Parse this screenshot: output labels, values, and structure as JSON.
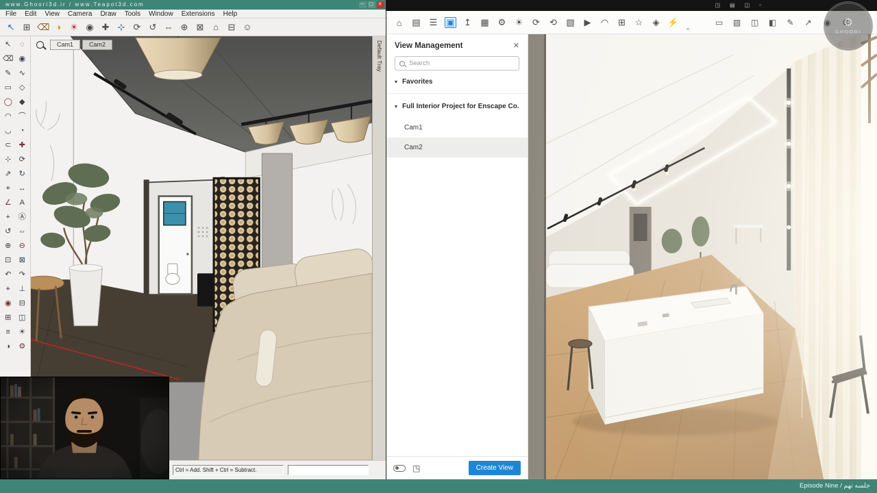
{
  "titlebar": {
    "title": "www.Ghoori3d.ir / www.Teapot3d.com",
    "minimize": "─",
    "maximize": "▢",
    "close": "✕"
  },
  "menu": {
    "items": [
      "File",
      "Edit",
      "View",
      "Camera",
      "Draw",
      "Tools",
      "Window",
      "Extensions",
      "Help"
    ]
  },
  "sketchup_toolbar": {
    "icons": [
      {
        "n": "select-icon",
        "g": "↖"
      },
      {
        "n": "make-component-icon",
        "g": "⊞"
      },
      {
        "n": "eraser-icon",
        "g": "⌫"
      },
      {
        "n": "styles-icon",
        "g": "◑"
      },
      {
        "n": "shadows-icon",
        "g": "☀"
      },
      {
        "n": "paint-bucket-icon",
        "g": "◉"
      },
      {
        "n": "push-pull-icon",
        "g": "✚"
      },
      {
        "n": "move-icon",
        "g": "⊹"
      },
      {
        "n": "rotate-icon",
        "g": "⟳"
      },
      {
        "n": "orbit-icon",
        "g": "↺"
      },
      {
        "n": "pan-icon",
        "g": "⇔"
      },
      {
        "n": "zoom-icon",
        "g": "⊕"
      },
      {
        "n": "zoom-extents-icon",
        "g": "⊠"
      },
      {
        "n": "warehouse-icon",
        "g": "⌂"
      },
      {
        "n": "cart-icon",
        "g": "⊟"
      },
      {
        "n": "user-icon",
        "g": "☺"
      }
    ]
  },
  "tool_palette": {
    "icons": [
      {
        "n": "select-icon",
        "g": "↖"
      },
      {
        "n": "lasso-icon",
        "g": "◌"
      },
      {
        "n": "eraser-icon",
        "g": "⌫"
      },
      {
        "n": "paint-bucket-icon",
        "g": "◉"
      },
      {
        "n": "line-icon",
        "g": "✎"
      },
      {
        "n": "freehand-icon",
        "g": "∿"
      },
      {
        "n": "rectangle-icon",
        "g": "▭"
      },
      {
        "n": "rotated-rectangle-icon",
        "g": "◇"
      },
      {
        "n": "circle-icon",
        "g": "◯"
      },
      {
        "n": "polygon-icon",
        "g": "◆"
      },
      {
        "n": "arc-icon",
        "g": "◠"
      },
      {
        "n": "two-point-arc-icon",
        "g": "⌒"
      },
      {
        "n": "three-point-arc-icon",
        "g": "◡"
      },
      {
        "n": "pie-icon",
        "g": "◔"
      },
      {
        "n": "offset-icon",
        "g": "⊂"
      },
      {
        "n": "push-pull-icon",
        "g": "✚"
      },
      {
        "n": "move-icon",
        "g": "⊹"
      },
      {
        "n": "rotate-icon",
        "g": "⟳"
      },
      {
        "n": "scale-icon",
        "g": "⇗"
      },
      {
        "n": "follow-me-icon",
        "g": "↻"
      },
      {
        "n": "tape-measure-icon",
        "g": "⌖"
      },
      {
        "n": "dimension-icon",
        "g": "↔"
      },
      {
        "n": "protractor-icon",
        "g": "∠"
      },
      {
        "n": "text-icon",
        "g": "A"
      },
      {
        "n": "axes-icon",
        "g": "+"
      },
      {
        "n": "3d-text-icon",
        "g": "Ⓐ"
      },
      {
        "n": "orbit-icon",
        "g": "↺"
      },
      {
        "n": "pan-icon",
        "g": "⇔"
      },
      {
        "n": "zoom-in-icon",
        "g": "⊕"
      },
      {
        "n": "zoom-out-icon",
        "g": "⊖"
      },
      {
        "n": "zoom-window-icon",
        "g": "⊡"
      },
      {
        "n": "zoom-extents-icon",
        "g": "⊠"
      },
      {
        "n": "previous-icon",
        "g": "↶"
      },
      {
        "n": "next-icon",
        "g": "↷"
      },
      {
        "n": "position-camera-icon",
        "g": "⌖"
      },
      {
        "n": "walk-icon",
        "g": "⊥"
      },
      {
        "n": "look-around-icon",
        "g": "◉"
      },
      {
        "n": "section-plane-icon",
        "g": "⊟"
      },
      {
        "n": "section-fill-icon",
        "g": "⊞"
      },
      {
        "n": "section-display-icon",
        "g": "◫"
      },
      {
        "n": "layers-icon",
        "g": "≡"
      },
      {
        "n": "shadows-icon",
        "g": "☀"
      },
      {
        "n": "styles-icon",
        "g": "◑"
      },
      {
        "n": "settings-icon",
        "g": "⚙"
      }
    ]
  },
  "viewport": {
    "tabs": [
      "Cam1",
      "Cam2"
    ]
  },
  "default_tray": {
    "label": "Default Tray"
  },
  "status": {
    "hint": "Ctrl = Add. Shift + Ctrl = Subtract.",
    "measurements_value": ""
  },
  "enscape": {
    "strip_icons": [
      {
        "n": "quick-icon-1",
        "g": "◳"
      },
      {
        "n": "quick-icon-2",
        "g": "▤"
      },
      {
        "n": "quick-icon-3",
        "g": "◫"
      },
      {
        "n": "quick-icon-4",
        "g": "▫"
      }
    ],
    "toolbar_left": [
      {
        "n": "home-icon",
        "g": "⌂"
      },
      {
        "n": "projects-icon",
        "g": "▤"
      },
      {
        "n": "bim-icon",
        "g": "☰"
      },
      {
        "n": "view-management-icon",
        "g": "▣",
        "a": "true"
      },
      {
        "n": "upload-icon",
        "g": "↥"
      },
      {
        "n": "asset-library-icon",
        "g": "▦"
      },
      {
        "n": "settings-icon",
        "g": "⚙"
      },
      {
        "n": "sun-icon",
        "g": "☀"
      },
      {
        "n": "sync-icon",
        "g": "⟳"
      },
      {
        "n": "live-update-icon",
        "g": "⟲"
      },
      {
        "n": "image-export-icon",
        "g": "▧"
      },
      {
        "n": "video-export-icon",
        "g": "▶"
      },
      {
        "n": "panorama-icon",
        "g": "◠"
      },
      {
        "n": "batch-export-icon",
        "g": "⊞"
      },
      {
        "n": "favorites-icon",
        "g": "☆"
      },
      {
        "n": "materials-icon",
        "g": "◈"
      },
      {
        "n": "light-icon",
        "g": "⚡"
      }
    ],
    "toolbar_right": [
      {
        "n": "safe-frame-icon",
        "g": "▭"
      },
      {
        "n": "screenshot-icon",
        "g": "▧"
      },
      {
        "n": "stereo-icon",
        "g": "◫"
      },
      {
        "n": "layers-icon",
        "g": "◧"
      },
      {
        "n": "annotate-icon",
        "g": "✎"
      },
      {
        "n": "share-icon",
        "g": "↗"
      }
    ],
    "toolbar_far_right": [
      {
        "n": "visibility-eye-icon",
        "g": "◉"
      },
      {
        "n": "render-settings-icon",
        "g": "⚙"
      }
    ],
    "collapse_glyph": "^",
    "watermark": {
      "text": "GHOORI",
      "gear_glyph": "⚙"
    },
    "panel": {
      "title": "View Management",
      "close_glyph": "✕",
      "search_placeholder": "Search",
      "caret_glyph": "▾",
      "favorites_label": "Favorites",
      "project_label": "Full Interior Project for Enscape Co...",
      "views": [
        "Cam1",
        "Cam2"
      ],
      "batch_icon_glyph": "◳",
      "create_view_label": "Create View"
    }
  },
  "footer": {
    "credit": "Episode Nine / جلسه نهم"
  },
  "colors": {
    "titlebar_teal": "#3f8577",
    "accent_blue": "#1b87d6"
  }
}
